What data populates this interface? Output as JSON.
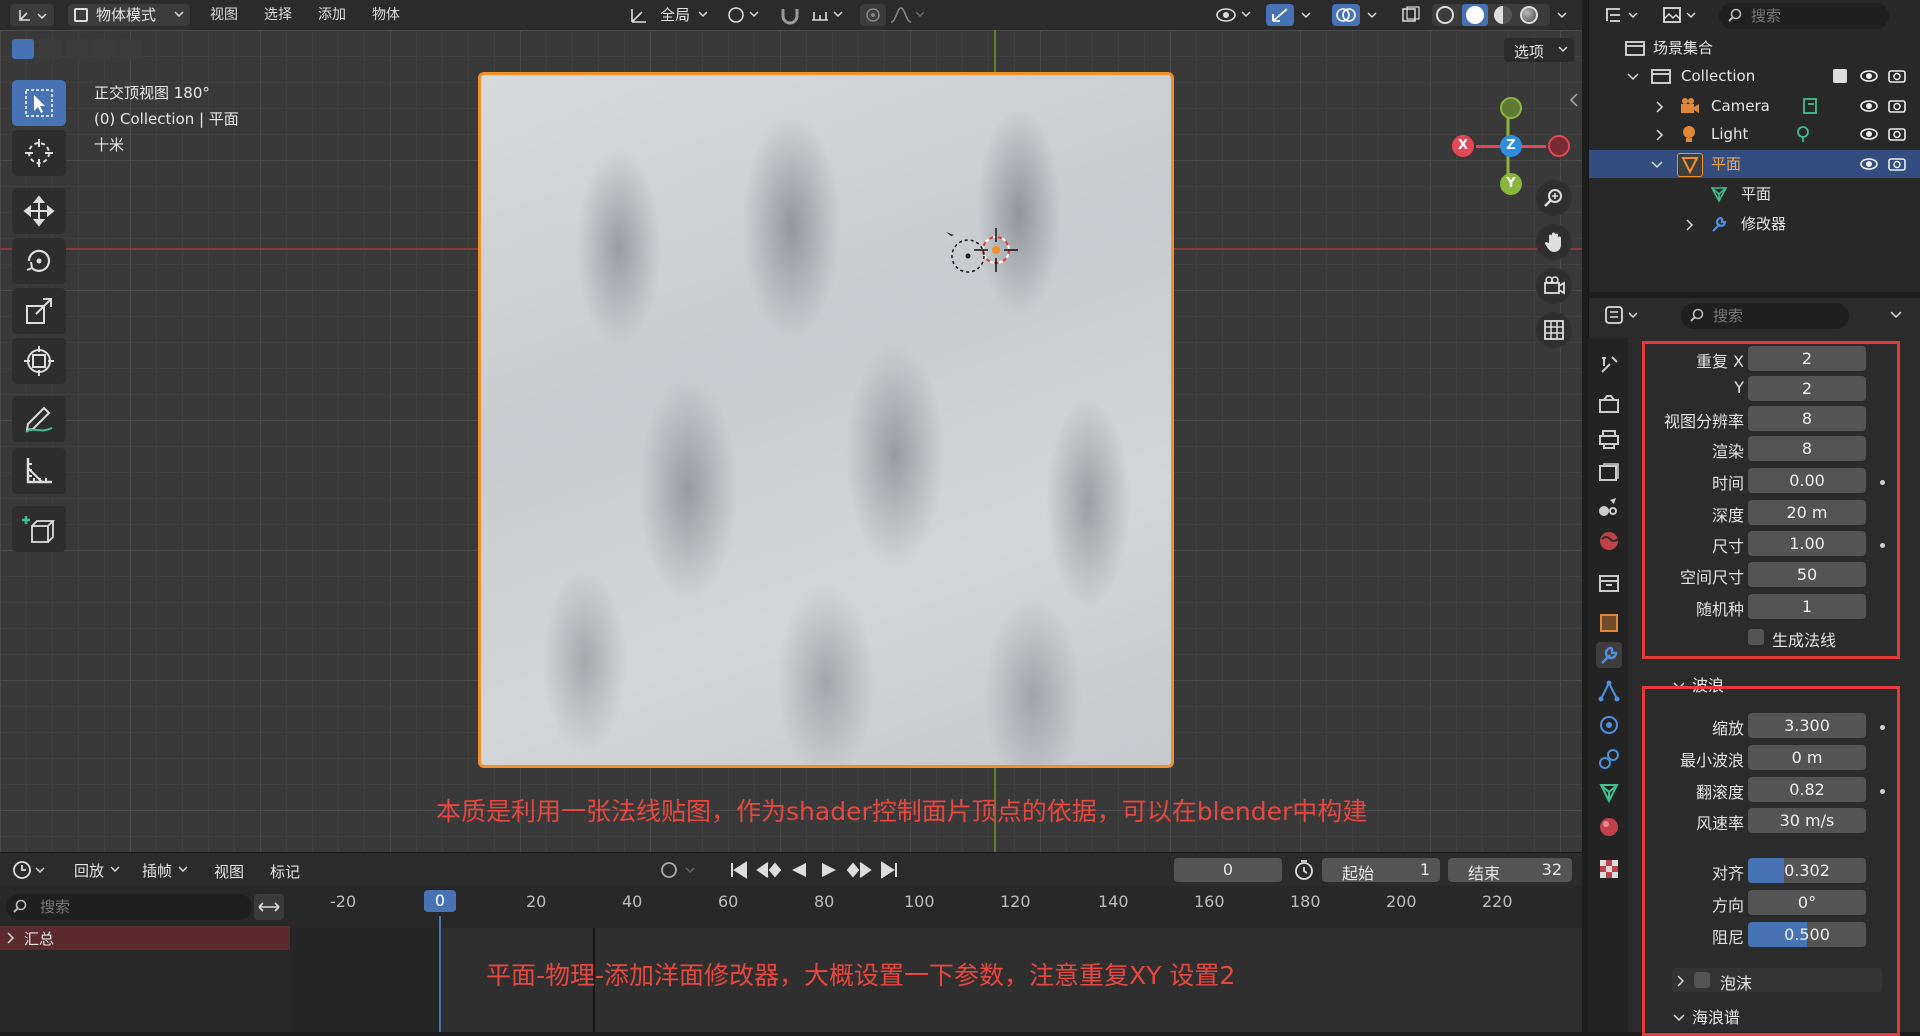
{
  "topbar": {
    "mode": "物体模式",
    "menus": [
      "视图",
      "选择",
      "添加",
      "物体"
    ],
    "transform_orientation": "全局",
    "options": "选项"
  },
  "viewport": {
    "view_name": "正交顶视图 180°",
    "collection_line": "(0) Collection | 平面",
    "scale_label": "十米",
    "overlay_text_1": "本质是利用一张法线贴图，作为shader控制面片顶点的依据，可以在blender中构建",
    "gizmo": {
      "x": "X",
      "y": "Y",
      "z": "Z"
    }
  },
  "timeline": {
    "menus": [
      "回放",
      "插帧",
      "视图",
      "标记"
    ],
    "current_frame": "0",
    "start_label": "起始",
    "start_value": "1",
    "end_label": "结束",
    "end_value": "32",
    "ruler": [
      "-20",
      "0",
      "20",
      "40",
      "60",
      "80",
      "100",
      "120",
      "140",
      "160",
      "180",
      "200",
      "220"
    ],
    "playhead": "0",
    "search_placeholder": "搜索",
    "summary": "汇总",
    "overlay_text_2": "平面-物理-添加洋面修改器，大概设置一下参数，注意重复XY 设置2"
  },
  "outliner": {
    "search_placeholder": "搜索",
    "scene_collection": "场景集合",
    "collection": "Collection",
    "camera": "Camera",
    "light": "Light",
    "plane": "平面",
    "plane_mesh": "平面",
    "modifiers": "修改器"
  },
  "properties": {
    "search_placeholder": "搜索",
    "fields_1": [
      {
        "label": "重复 X",
        "value": "2"
      },
      {
        "label": "Y",
        "value": "2"
      },
      {
        "label": "视图分辨率",
        "value": "8"
      },
      {
        "label": "渲染",
        "value": "8"
      },
      {
        "label": "时间",
        "value": "0.00"
      },
      {
        "label": "深度",
        "value": "20 m"
      },
      {
        "label": "尺寸",
        "value": "1.00"
      },
      {
        "label": "空间尺寸",
        "value": "50"
      },
      {
        "label": "随机种",
        "value": "1"
      }
    ],
    "generate_normals": "生成法线",
    "waves_panel": "波浪",
    "fields_2": [
      {
        "label": "缩放",
        "value": "3.300"
      },
      {
        "label": "最小波浪",
        "value": "0 m"
      },
      {
        "label": "翻滚度",
        "value": "0.82"
      },
      {
        "label": "风速率",
        "value": "30 m/s"
      }
    ],
    "fields_3": [
      {
        "label": "对齐",
        "value": "0.302",
        "fill": 0.302
      },
      {
        "label": "方向",
        "value": "0°",
        "fill": 0
      },
      {
        "label": "阻尼",
        "value": "0.500",
        "fill": 0.5
      }
    ],
    "foam_panel": "泡沫",
    "spectrum_panel": "海浪谱"
  },
  "colors": {
    "selection_orange": "#f0902a",
    "annotation_red": "#e33a3a",
    "accent_blue": "#4772b3"
  }
}
